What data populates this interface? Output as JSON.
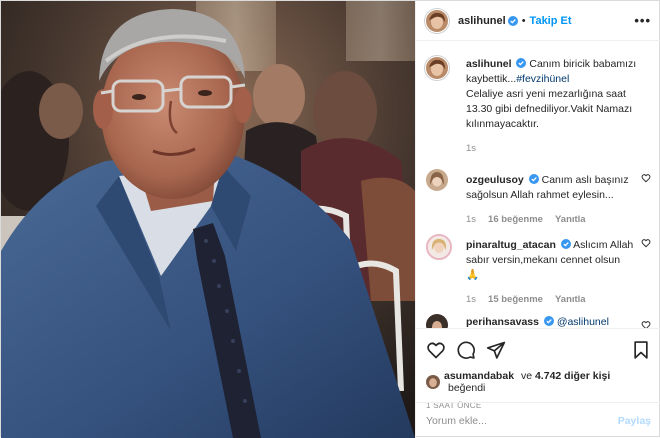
{
  "header": {
    "username": "aslihunel",
    "separator": "•",
    "follow_label": "Takip Et",
    "more_label": "•••"
  },
  "caption": {
    "username": "aslihunel",
    "text_1": "Canım biricik babamızı kaybettik...",
    "hashtag": "#fevzihünel",
    "text_2": "Celaliye asri yeni mezarlığına saat 13.30 gibi defnediliyor.Vakit Namazı kılınmayacaktır.",
    "time": "1s"
  },
  "comments": [
    {
      "username": "ozgeulusoy",
      "text": "Canım aslı başınız sağolsun Allah rahmet eylesin...",
      "time": "1s",
      "likes": "16 beğenme",
      "reply": "Yanıtla"
    },
    {
      "username": "pinaraltug_atacan",
      "text": "Aslıcım Allah sabır versin,mekanı cennet olsun",
      "emoji": "🙏",
      "time": "1s",
      "likes": "15 beğenme",
      "reply": "Yanıtla"
    },
    {
      "username": "perihansavass",
      "mention": "@aslihunel"
    }
  ],
  "likes_row": {
    "user": "asumandabak",
    "and_label": "ve",
    "others": "4.742 diğer kişi",
    "suffix": "beğendi"
  },
  "post_time": "1 SAAT ÖNCE",
  "add_comment": {
    "placeholder": "Yorum ekle...",
    "post_label": "Paylaş"
  },
  "colors": {
    "link_blue": "#0095f6",
    "verified_blue": "#3897f0",
    "muted": "#8e8e8e",
    "border": "#dbdbdb",
    "suit_blue": "#3d5b86"
  },
  "icons": [
    "verified-badge-icon",
    "heart-icon",
    "comment-icon",
    "share-icon",
    "bookmark-icon",
    "more-icon"
  ]
}
